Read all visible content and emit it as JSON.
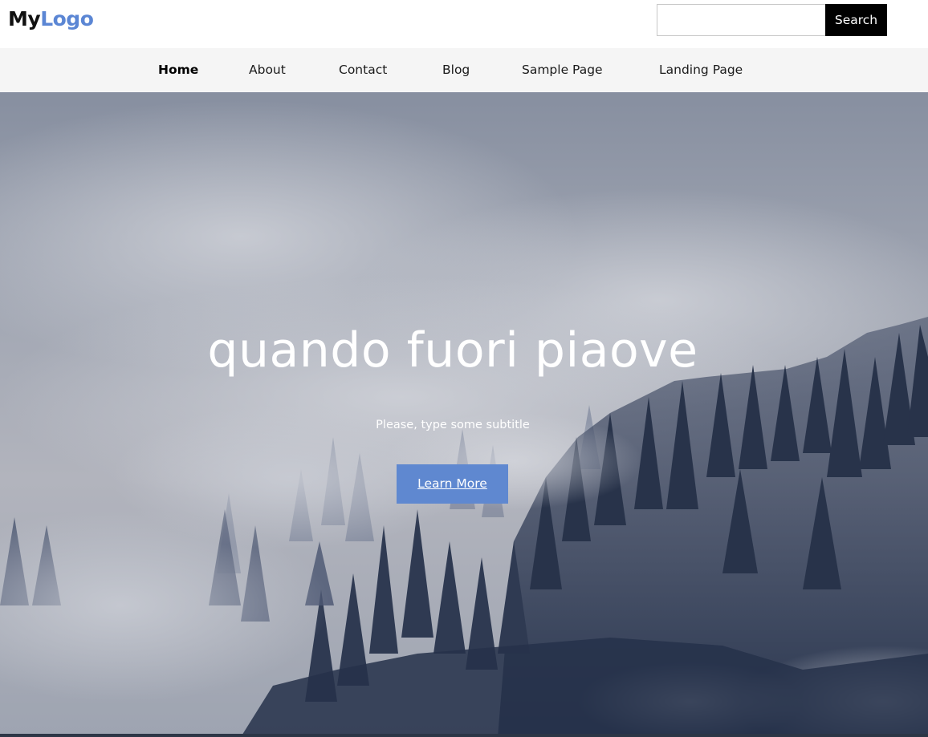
{
  "header": {
    "logo_part1": "My",
    "logo_part2": "Logo",
    "search": {
      "placeholder": "",
      "value": "",
      "button_label": "Search"
    }
  },
  "nav": {
    "items": [
      {
        "label": "Home",
        "active": true
      },
      {
        "label": "About"
      },
      {
        "label": "Contact"
      },
      {
        "label": "Blog"
      },
      {
        "label": "Sample Page"
      },
      {
        "label": "Landing Page"
      }
    ]
  },
  "hero": {
    "title": "quando fuori piaove",
    "subtitle": "Please, type some subtitle",
    "cta_label": "Learn More"
  },
  "colors": {
    "accent": "#5f88d0",
    "logo_accent": "#5b86d4",
    "nav_background": "#f5f5f5",
    "search_button": "#000000"
  }
}
